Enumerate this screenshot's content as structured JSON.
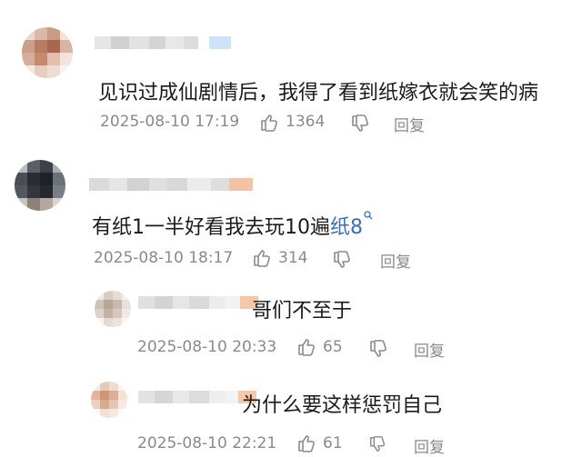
{
  "comments": [
    {
      "text": "见识过成仙剧情后，我得了看到纸嫁衣就会笑的病",
      "timestamp": "2025-08-10 17:19",
      "likes": "1364",
      "reply_label": "回复",
      "icons": [
        "like-icon",
        "dislike-icon"
      ]
    },
    {
      "text": "有纸1一半好看我去玩10遍",
      "linked_text": "纸8",
      "timestamp": "2025-08-10 18:17",
      "likes": "314",
      "reply_label": "回复",
      "icons": [
        "like-icon",
        "dislike-icon",
        "search-icon"
      ]
    },
    {
      "text": "哥们不至于",
      "timestamp": "2025-08-10 20:33",
      "likes": "65",
      "reply_label": "回复",
      "icons": [
        "like-icon",
        "dislike-icon"
      ]
    },
    {
      "text": "为什么要这样惩罚自己",
      "timestamp": "2025-08-10 22:21",
      "likes": "61",
      "reply_label": "回复",
      "icons": [
        "like-icon",
        "dislike-icon"
      ]
    }
  ],
  "colors": {
    "text": "#1a1a1a",
    "meta": "#8a8a8a",
    "link": "#3b6fb6",
    "background": "#ffffff"
  }
}
